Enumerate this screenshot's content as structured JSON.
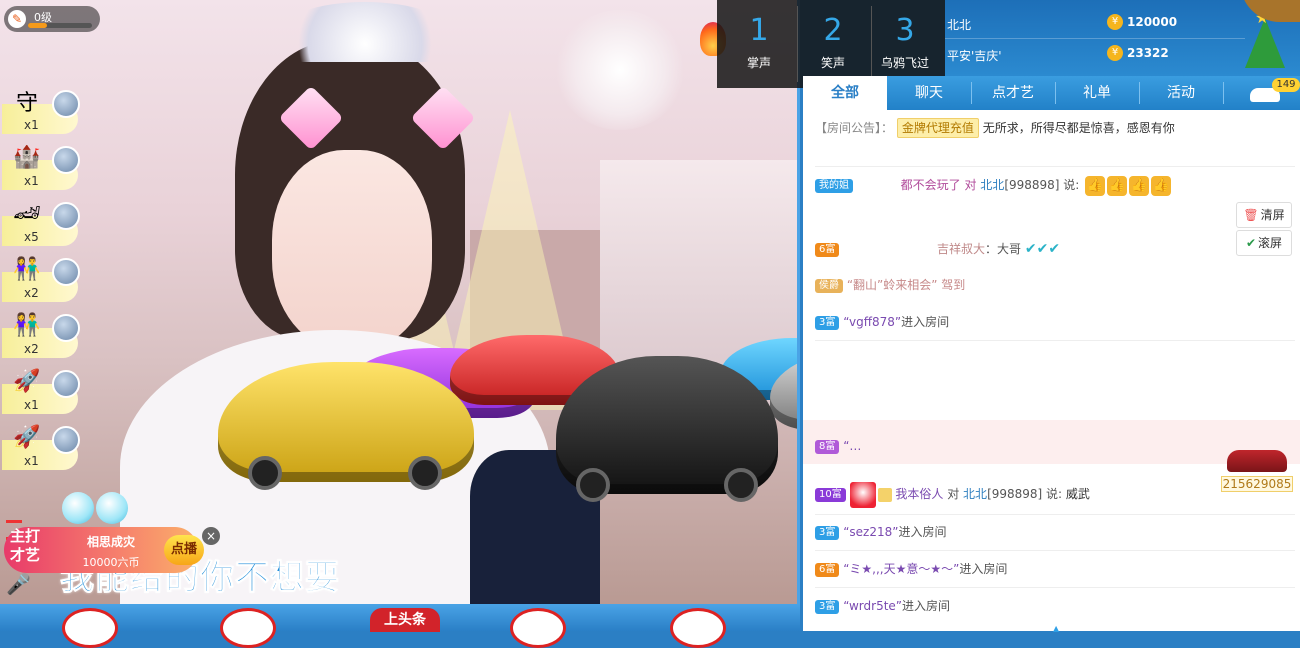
{
  "video": {
    "level": {
      "text": "0级",
      "progress": 0.3
    },
    "gifts": [
      {
        "icon": "shield-gift-icon",
        "glyph": "守",
        "count": "x1"
      },
      {
        "icon": "castle-gift-icon",
        "glyph": "🏰",
        "count": "x1"
      },
      {
        "icon": "sports-car-gift-icon",
        "glyph": "🏎",
        "count": "x5"
      },
      {
        "icon": "couple-gift-icon",
        "glyph": "👫",
        "count": "x2"
      },
      {
        "icon": "couple-gift-icon",
        "glyph": "👫",
        "count": "x2"
      },
      {
        "icon": "rocket-gift-icon",
        "glyph": "🚀",
        "count": "x1"
      },
      {
        "icon": "rocket-gift-icon",
        "glyph": "🚀",
        "count": "x1"
      }
    ],
    "feature": {
      "badge": "主打才艺",
      "badge_line1": "主打",
      "badge_line2": "才艺",
      "title": "相思成灾",
      "price": "10000六币",
      "button": "点播",
      "close": "×"
    },
    "lyric": "我能给的你不想要",
    "bottom_label": "上头条"
  },
  "vote": [
    {
      "num": "1",
      "label": "掌声"
    },
    {
      "num": "2",
      "label": "笑声"
    },
    {
      "num": "3",
      "label": "乌鸦飞过"
    }
  ],
  "rank": [
    {
      "name": "北北",
      "value": "120000"
    },
    {
      "name": "平安'吉庆'",
      "value": "23322"
    }
  ],
  "tabs": [
    "全部",
    "聊天",
    "点才艺",
    "礼单",
    "活动"
  ],
  "car_count": "149",
  "chat": {
    "notice_label": "【房间公告】：",
    "notice_tag": "金牌代理充值",
    "notice_text": "无所求，所得尽都是惊喜，感恩有你",
    "clear_button": "清屏",
    "scroll_button": "滚屏",
    "lines": [
      {
        "badge": "我的姐",
        "text_before": "都不会玩了 对 ",
        "target": "北北",
        "id": "[998898] 说:"
      },
      {
        "badge": "6富",
        "user": "吉祥叔大",
        "text": "：大哥"
      },
      {
        "badge": "侯爵",
        "quote": "“翻山”蛉来相会” 驾到"
      },
      {
        "badge": "3富",
        "user": "“vgff878”",
        "text": "进入房间"
      },
      {
        "badge": "8富",
        "user": "“…",
        "text": ""
      },
      {
        "badge": "10富",
        "user": "我本俗人",
        "text_before": " 对 ",
        "target": "北北",
        "id": "[998898] 说: ",
        "text": "威武"
      },
      {
        "badge": "3富",
        "user": "“sez218”",
        "text": "进入房间"
      },
      {
        "badge": "6富",
        "user": "“ミ★,,,天★意～★～”",
        "text": "进入房间"
      },
      {
        "badge": "3富",
        "user": "“wrdr5te”",
        "text": "进入房间"
      }
    ],
    "car_value": "215629085"
  }
}
